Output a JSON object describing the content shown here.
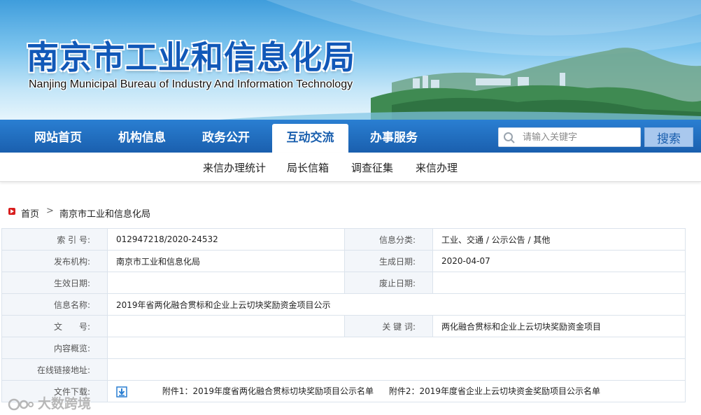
{
  "banner": {
    "title": "南京市工业和信息化局",
    "subtitle": "Nanjing Municipal Bureau of Industry And Information Technology"
  },
  "nav": {
    "items": [
      {
        "label": "网站首页"
      },
      {
        "label": "机构信息"
      },
      {
        "label": "政务公开"
      },
      {
        "label": "互动交流",
        "active": true
      },
      {
        "label": "办事服务"
      }
    ],
    "search_placeholder": "请输入关键字",
    "search_button": "搜索"
  },
  "subnav": {
    "items": [
      {
        "label": "来信办理统计"
      },
      {
        "label": "局长信箱"
      },
      {
        "label": "调查征集"
      },
      {
        "label": "来信办理"
      }
    ]
  },
  "breadcrumb": {
    "home": "首页",
    "separator": ">",
    "current": "南京市工业和信息化局"
  },
  "info": {
    "index_label": "索 引 号:",
    "index_value": "012947218/2020-24532",
    "category_label": "信息分类:",
    "category_value": "工业、交通 / 公示公告 / 其他",
    "publisher_label": "发布机构:",
    "publisher_value": "南京市工业和信息化局",
    "created_label": "生成日期:",
    "created_value": "2020-04-07",
    "effective_label": "生效日期:",
    "effective_value": "",
    "expiry_label": "废止日期:",
    "expiry_value": "",
    "name_label": "信息名称:",
    "name_value": "2019年省两化融合贯标和企业上云切块奖励资金项目公示",
    "docno_label": "文　　号:",
    "docno_value": "",
    "keywords_label": "关 键 词:",
    "keywords_value": "两化融合贯标和企业上云切块奖励资金项目",
    "summary_label": "内容概览:",
    "summary_value": "",
    "link_label": "在线链接地址:",
    "link_value": "",
    "download_label": "文件下载:",
    "attachments": [
      "附件1：2019年度省两化融合贯标切块奖励项目公示名单",
      "附件2：2019年度省企业上云切块资金奖励项目公示名单"
    ]
  },
  "watermark": "大数跨境",
  "colors": {
    "nav_blue": "#1a5fae",
    "accent_red": "#d81e1e",
    "label_bg": "#f3f6fa"
  }
}
